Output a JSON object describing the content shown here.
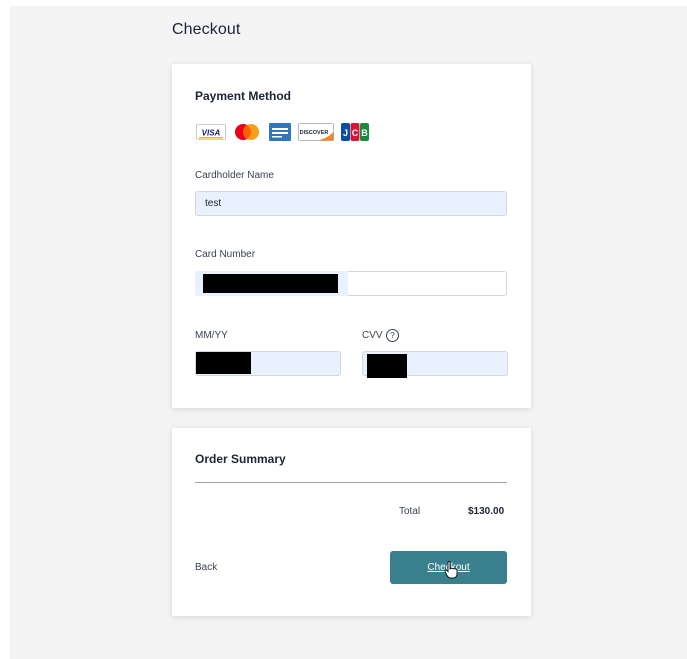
{
  "page": {
    "title": "Checkout"
  },
  "payment": {
    "title": "Payment Method",
    "logos": [
      {
        "name": "visa-logo",
        "text": "VISA",
        "color": "#1a1f71"
      },
      {
        "name": "mastercard-logo",
        "text": "",
        "color": "#eb001b"
      },
      {
        "name": "amex-logo",
        "text": "",
        "color": "#2e77bc"
      },
      {
        "name": "discover-logo",
        "text": "DISCOVER",
        "color": "#f58220"
      },
      {
        "name": "jcb-logo",
        "text": "JCB",
        "color": "#0b4ea2"
      }
    ],
    "cardholder_label": "Cardholder Name",
    "cardholder_value": "test",
    "card_number_label": "Card Number",
    "expiry_label": "MM/YY",
    "cvv_label": "CVV",
    "cvv_help_icon": "?"
  },
  "summary": {
    "title": "Order Summary",
    "total_label": "Total",
    "total_value": "$130.00",
    "back_label": "Back",
    "checkout_label": "Checkout"
  },
  "colors": {
    "accent": "#3a7f8e",
    "field_fill": "#e9f0fe",
    "page_bg": "#f4f4f4"
  },
  "icons": [
    "hand-pointer-cursor-icon",
    "question-circle-icon"
  ]
}
